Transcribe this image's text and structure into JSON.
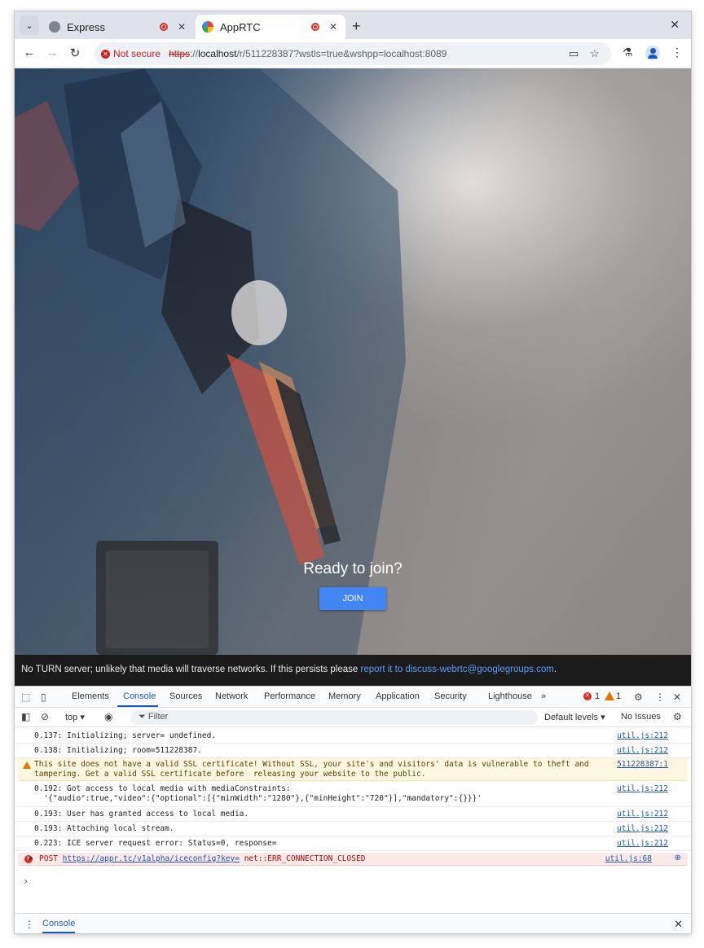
{
  "browser": {
    "tabs": [
      {
        "title": "Express",
        "recording": true
      },
      {
        "title": "AppRTC",
        "recording": true
      }
    ],
    "security_label": "Not secure",
    "url": {
      "scheme": "https",
      "sep": "://",
      "host": "localhost",
      "path": "/r/511228387?wstls=true&wshpp=localhost:8089"
    },
    "icons": {
      "tab_search": "chevron-down-icon",
      "back": "back-arrow-icon",
      "forward": "forward-arrow-icon",
      "reload": "reload-icon",
      "camera": "camera-icon",
      "bookmark": "star-icon",
      "labs": "flask-icon",
      "menu": "kebab-menu-icon"
    }
  },
  "page": {
    "ready_text": "Ready to join?",
    "join_label": "JOIN",
    "notice_text": "No TURN server; unlikely that media will traverse networks. If this persists please ",
    "notice_link": "report it to discuss-webrtc@googlegroups.com",
    "notice_end": "."
  },
  "devtools": {
    "tabs": [
      "Elements",
      "Console",
      "Sources",
      "Network",
      "Performance",
      "Memory",
      "Application",
      "Security",
      "Lighthouse"
    ],
    "active_tab": "Console",
    "error_count": "1",
    "warning_count": "1",
    "context": "top",
    "filter_placeholder": "Filter",
    "levels": "Default levels",
    "issues": "No Issues",
    "logs": [
      {
        "type": "info",
        "text": "0.137: Initializing; server= undefined.",
        "source": "util.js:212"
      },
      {
        "type": "info",
        "text": "0.138: Initializing; room=511228387.",
        "source": "util.js:212"
      },
      {
        "type": "warning",
        "text": "This site does not have a valid SSL certificate! Without SSL, your site's and visitors' data is vulnerable to theft and\ntampering. Get a valid SSL certificate before  releasing your website to the public.",
        "source": "511228387:1"
      },
      {
        "type": "info",
        "text": "0.192: Got access to local media with mediaConstraints:\n  '{\"audio\":true,\"video\":{\"optional\":[{\"minWidth\":\"1280\"},{\"minHeight\":\"720\"}],\"mandatory\":{}}}'",
        "source": "util.js:212"
      },
      {
        "type": "info",
        "text": "0.193: User has granted access to local media.",
        "source": "util.js:212"
      },
      {
        "type": "info",
        "text": "0.193: Attaching local stream.",
        "source": "util.js:212"
      },
      {
        "type": "info",
        "text": "0.223: ICE server request error: Status=0, response=",
        "source": "util.js:212"
      }
    ],
    "error_log": {
      "method": "POST",
      "url": "https://appr.tc/v1alpha/iceconfig?key=",
      "error": "net::ERR_CONNECTION_CLOSED",
      "source": "util.js:68"
    },
    "drawer_title": "Console"
  }
}
